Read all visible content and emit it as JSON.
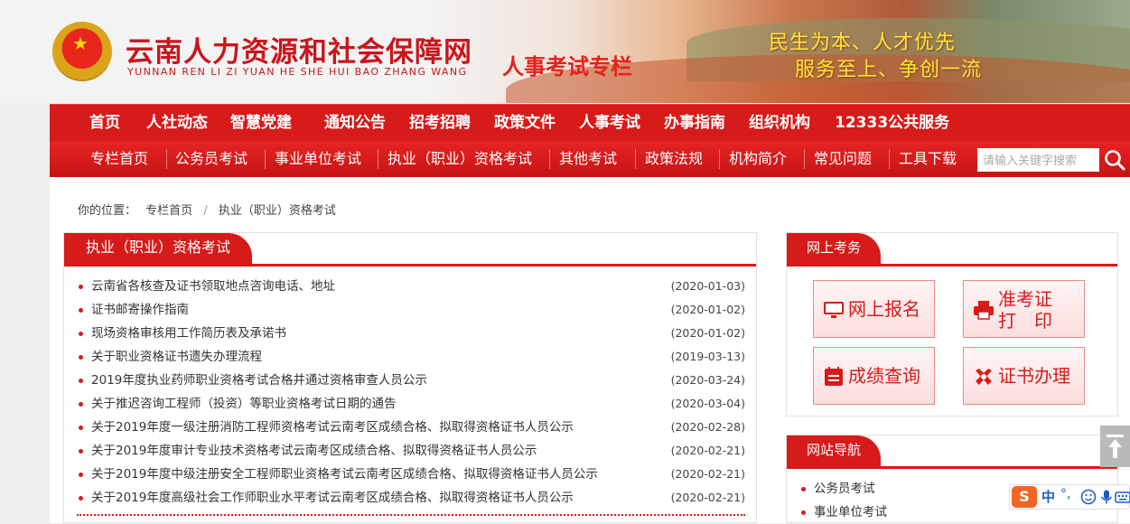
{
  "header": {
    "site_title": "云南人力资源和社会保障网",
    "site_pinyin": "YUNNAN REN LI ZI YUAN HE SHE HUI BAO ZHANG WANG",
    "special_title": "人事考试专栏",
    "slogan_line1": "民生为本、人才优先",
    "slogan_line2": "服务至上、争创一流"
  },
  "main_nav": [
    "首页",
    "人社动态",
    "智慧党建",
    "通知公告",
    "招考招聘",
    "政策文件",
    "人事考试",
    "办事指南",
    "组织机构",
    "12333公共服务"
  ],
  "sub_nav": [
    "专栏首页",
    "公务员考试",
    "事业单位考试",
    "执业（职业）资格考试",
    "其他考试",
    "政策法规",
    "机构简介",
    "常见问题",
    "工具下载"
  ],
  "search": {
    "placeholder": "请输入关键字搜索"
  },
  "breadcrumb": {
    "prefix": "你的位置：",
    "items": [
      "专栏首页",
      "执业（职业）资格考试"
    ]
  },
  "news_panel": {
    "title": "执业（职业）资格考试",
    "items": [
      {
        "title": "云南省各核查及证书领取地点咨询电话、地址",
        "date": "(2020-01-03)"
      },
      {
        "title": "证书邮寄操作指南",
        "date": "(2020-01-02)"
      },
      {
        "title": "现场资格审核用工作简历表及承诺书",
        "date": "(2020-01-02)"
      },
      {
        "title": "关于职业资格证书遗失办理流程",
        "date": "(2019-03-13)"
      },
      {
        "title": "2019年度执业药师职业资格考试合格并通过资格审查人员公示",
        "date": "(2020-03-24)"
      },
      {
        "title": "关于推迟咨询工程师（投资）等职业资格考试日期的通告",
        "date": "(2020-03-04)"
      },
      {
        "title": "关于2019年度一级注册消防工程师资格考试云南考区成绩合格、拟取得资格证书人员公示",
        "date": "(2020-02-28)"
      },
      {
        "title": "关于2019年度审计专业技术资格考试云南考区成绩合格、拟取得资格证书人员公示",
        "date": "(2020-02-21)"
      },
      {
        "title": "关于2019年度中级注册安全工程师职业资格考试云南考区成绩合格、拟取得资格证书人员公示",
        "date": "(2020-02-21)"
      },
      {
        "title": "关于2019年度高级社会工作师职业水平考试云南考区成绩合格、拟取得资格证书人员公示",
        "date": "(2020-02-21)"
      }
    ]
  },
  "online_exam": {
    "title": "网上考务",
    "buttons": {
      "register": "网上报名",
      "admit_line1": "准考证",
      "admit_line2": "打　印",
      "score": "成绩查询",
      "certificate": "证书办理"
    }
  },
  "site_guide": {
    "title": "网站导航",
    "items": [
      "公务员考试",
      "事业单位考试"
    ]
  },
  "ime": {
    "logo": "S",
    "lang": "中",
    "punct": "°,"
  },
  "colors": {
    "primary_red": "#d71a1a",
    "slogan_yellow": "#ffe53a"
  }
}
